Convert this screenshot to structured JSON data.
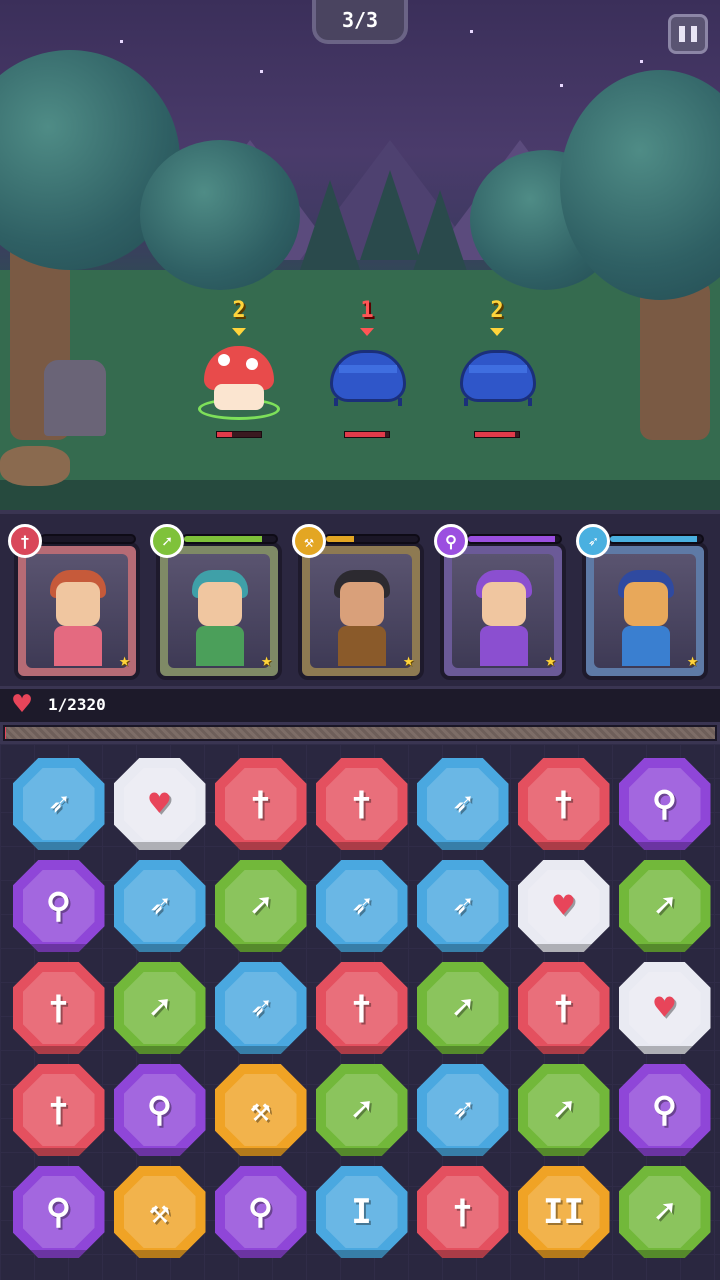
{
  "header": {
    "wave": "3/3"
  },
  "enemies": [
    {
      "name": "mushroom",
      "turns": "2",
      "turn_color": "yellow",
      "hp_fraction": 0.35
    },
    {
      "name": "blue-beetle",
      "turns": "1",
      "turn_color": "red",
      "hp_fraction": 0.9
    },
    {
      "name": "goggle-beetle",
      "turns": "2",
      "turn_color": "yellow",
      "hp_fraction": 0.9
    }
  ],
  "heroes": [
    {
      "class": "sword",
      "class_icon": "sword-icon",
      "color": "#d9475a",
      "frame": "#b66b75",
      "charge_fraction": 0,
      "star": "★"
    },
    {
      "class": "spear",
      "class_icon": "spear-icon",
      "color": "#7fc23a",
      "frame": "#7f8a66",
      "charge_fraction": 0.85,
      "star": "★"
    },
    {
      "class": "axe",
      "class_icon": "axe-icon",
      "color": "#e3a623",
      "frame": "#8e7a52",
      "charge_fraction": 0.3,
      "star": "★"
    },
    {
      "class": "wand",
      "class_icon": "wand-icon",
      "color": "#9b4fe0",
      "frame": "#6b5a98",
      "charge_fraction": 0.95,
      "star": "★"
    },
    {
      "class": "bow",
      "class_icon": "bow-icon",
      "color": "#4ab0e0",
      "frame": "#5e7aa6",
      "charge_fraction": 0.95,
      "star": "★"
    }
  ],
  "party_hp": {
    "label": "1/2320",
    "fraction": 0.0004
  },
  "gem_colors": {
    "bow": "#4aa8e0",
    "heart": "#e9eaf2",
    "sword": "#e4505f",
    "wand": "#8f46d8",
    "spear": "#72b83a",
    "axe": "#f0a325",
    "special_bow": "#4aa8e0",
    "special_axe": "#f0a325"
  },
  "gem_glyphs": {
    "bow": "➶",
    "heart": "♥",
    "sword": "†",
    "wand": "⚲",
    "spear": "➚",
    "axe": "⚒",
    "special_bow": "I",
    "special_axe": "II"
  },
  "board": [
    [
      "bow",
      "heart",
      "sword",
      "sword",
      "bow",
      "sword",
      "wand"
    ],
    [
      "wand",
      "bow",
      "spear",
      "bow",
      "bow",
      "heart",
      "spear"
    ],
    [
      "sword",
      "spear",
      "bow",
      "sword",
      "spear",
      "sword",
      "heart"
    ],
    [
      "sword",
      "wand",
      "axe",
      "spear",
      "bow",
      "spear",
      "wand"
    ],
    [
      "wand",
      "axe",
      "wand",
      "special_bow",
      "sword",
      "special_axe",
      "spear"
    ]
  ]
}
